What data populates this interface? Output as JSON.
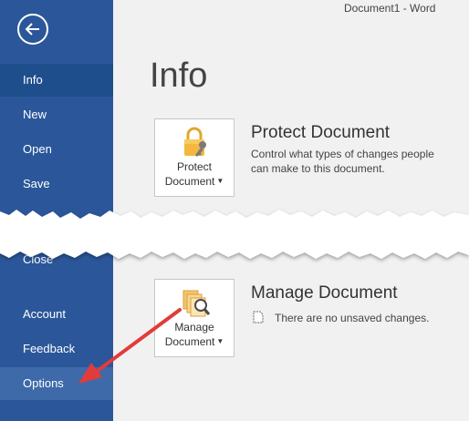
{
  "window": {
    "title": "Document1  -  Word"
  },
  "sidebar": {
    "back_icon": "back-arrow-icon",
    "items": [
      {
        "label": "Info"
      },
      {
        "label": "New"
      },
      {
        "label": "Open"
      },
      {
        "label": "Save"
      },
      {
        "label": "Close"
      },
      {
        "label": "Account"
      },
      {
        "label": "Feedback"
      },
      {
        "label": "Options"
      }
    ]
  },
  "main": {
    "title": "Info",
    "protect": {
      "button_line1": "Protect",
      "button_line2": "Document",
      "title": "Protect Document",
      "description_line1": "Control what types of changes people",
      "description_line2": "can make to this document.",
      "icon": "lock-key-icon"
    },
    "manage": {
      "button_line1": "Manage",
      "button_line2": "Document",
      "title": "Manage Document",
      "description": "There are no unsaved changes.",
      "icon": "documents-search-icon"
    }
  },
  "colors": {
    "sidebar": "#2b579a",
    "sidebar_active": "#1e4e8c",
    "arrow": "#e23b3b"
  }
}
